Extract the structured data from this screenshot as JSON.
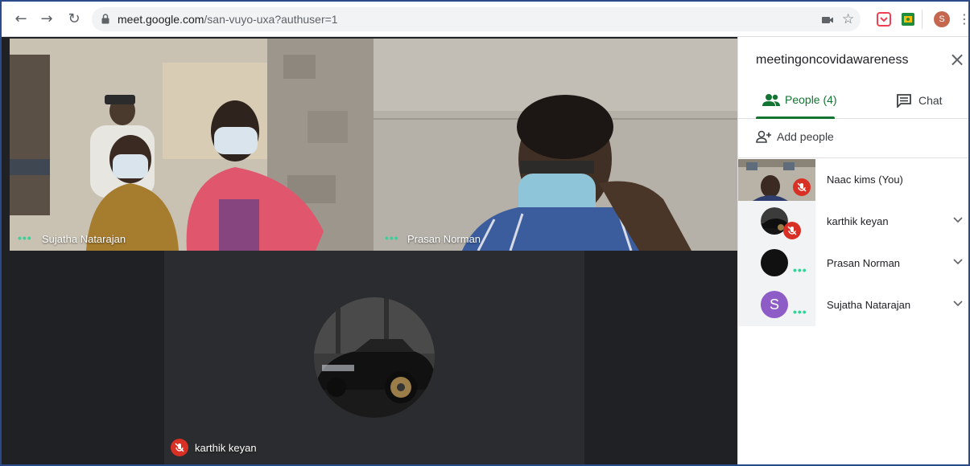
{
  "browser": {
    "url_host": "meet.google.com",
    "url_path": "/san-vuyo-uxa?authuser=1",
    "profile_initial": "S"
  },
  "tiles": {
    "top_left": {
      "name": "Sujatha Natarajan"
    },
    "top_right": {
      "name": "Prasan Norman"
    },
    "bottom": {
      "name": "karthik keyan"
    }
  },
  "panel": {
    "meeting_title": "meetingoncovidawareness",
    "close_icon": "close-icon",
    "tabs": [
      {
        "label": "People (4)",
        "icon": "people-icon",
        "active": true
      },
      {
        "label": "Chat",
        "icon": "chat-icon",
        "active": false
      }
    ],
    "add_people_label": "Add people",
    "participants": [
      {
        "name": "Naac kims (You)",
        "muted": true
      },
      {
        "name": "karthik keyan",
        "muted": true
      },
      {
        "name": "Prasan Norman",
        "muted": false
      },
      {
        "name": "Sujatha Natarajan",
        "muted": false,
        "avatar_initial": "S"
      }
    ]
  },
  "colors": {
    "accent_green": "#137333",
    "mute_red": "#d93025",
    "stage_bg": "#202124",
    "avatar_purple": "#8e5cc7"
  }
}
